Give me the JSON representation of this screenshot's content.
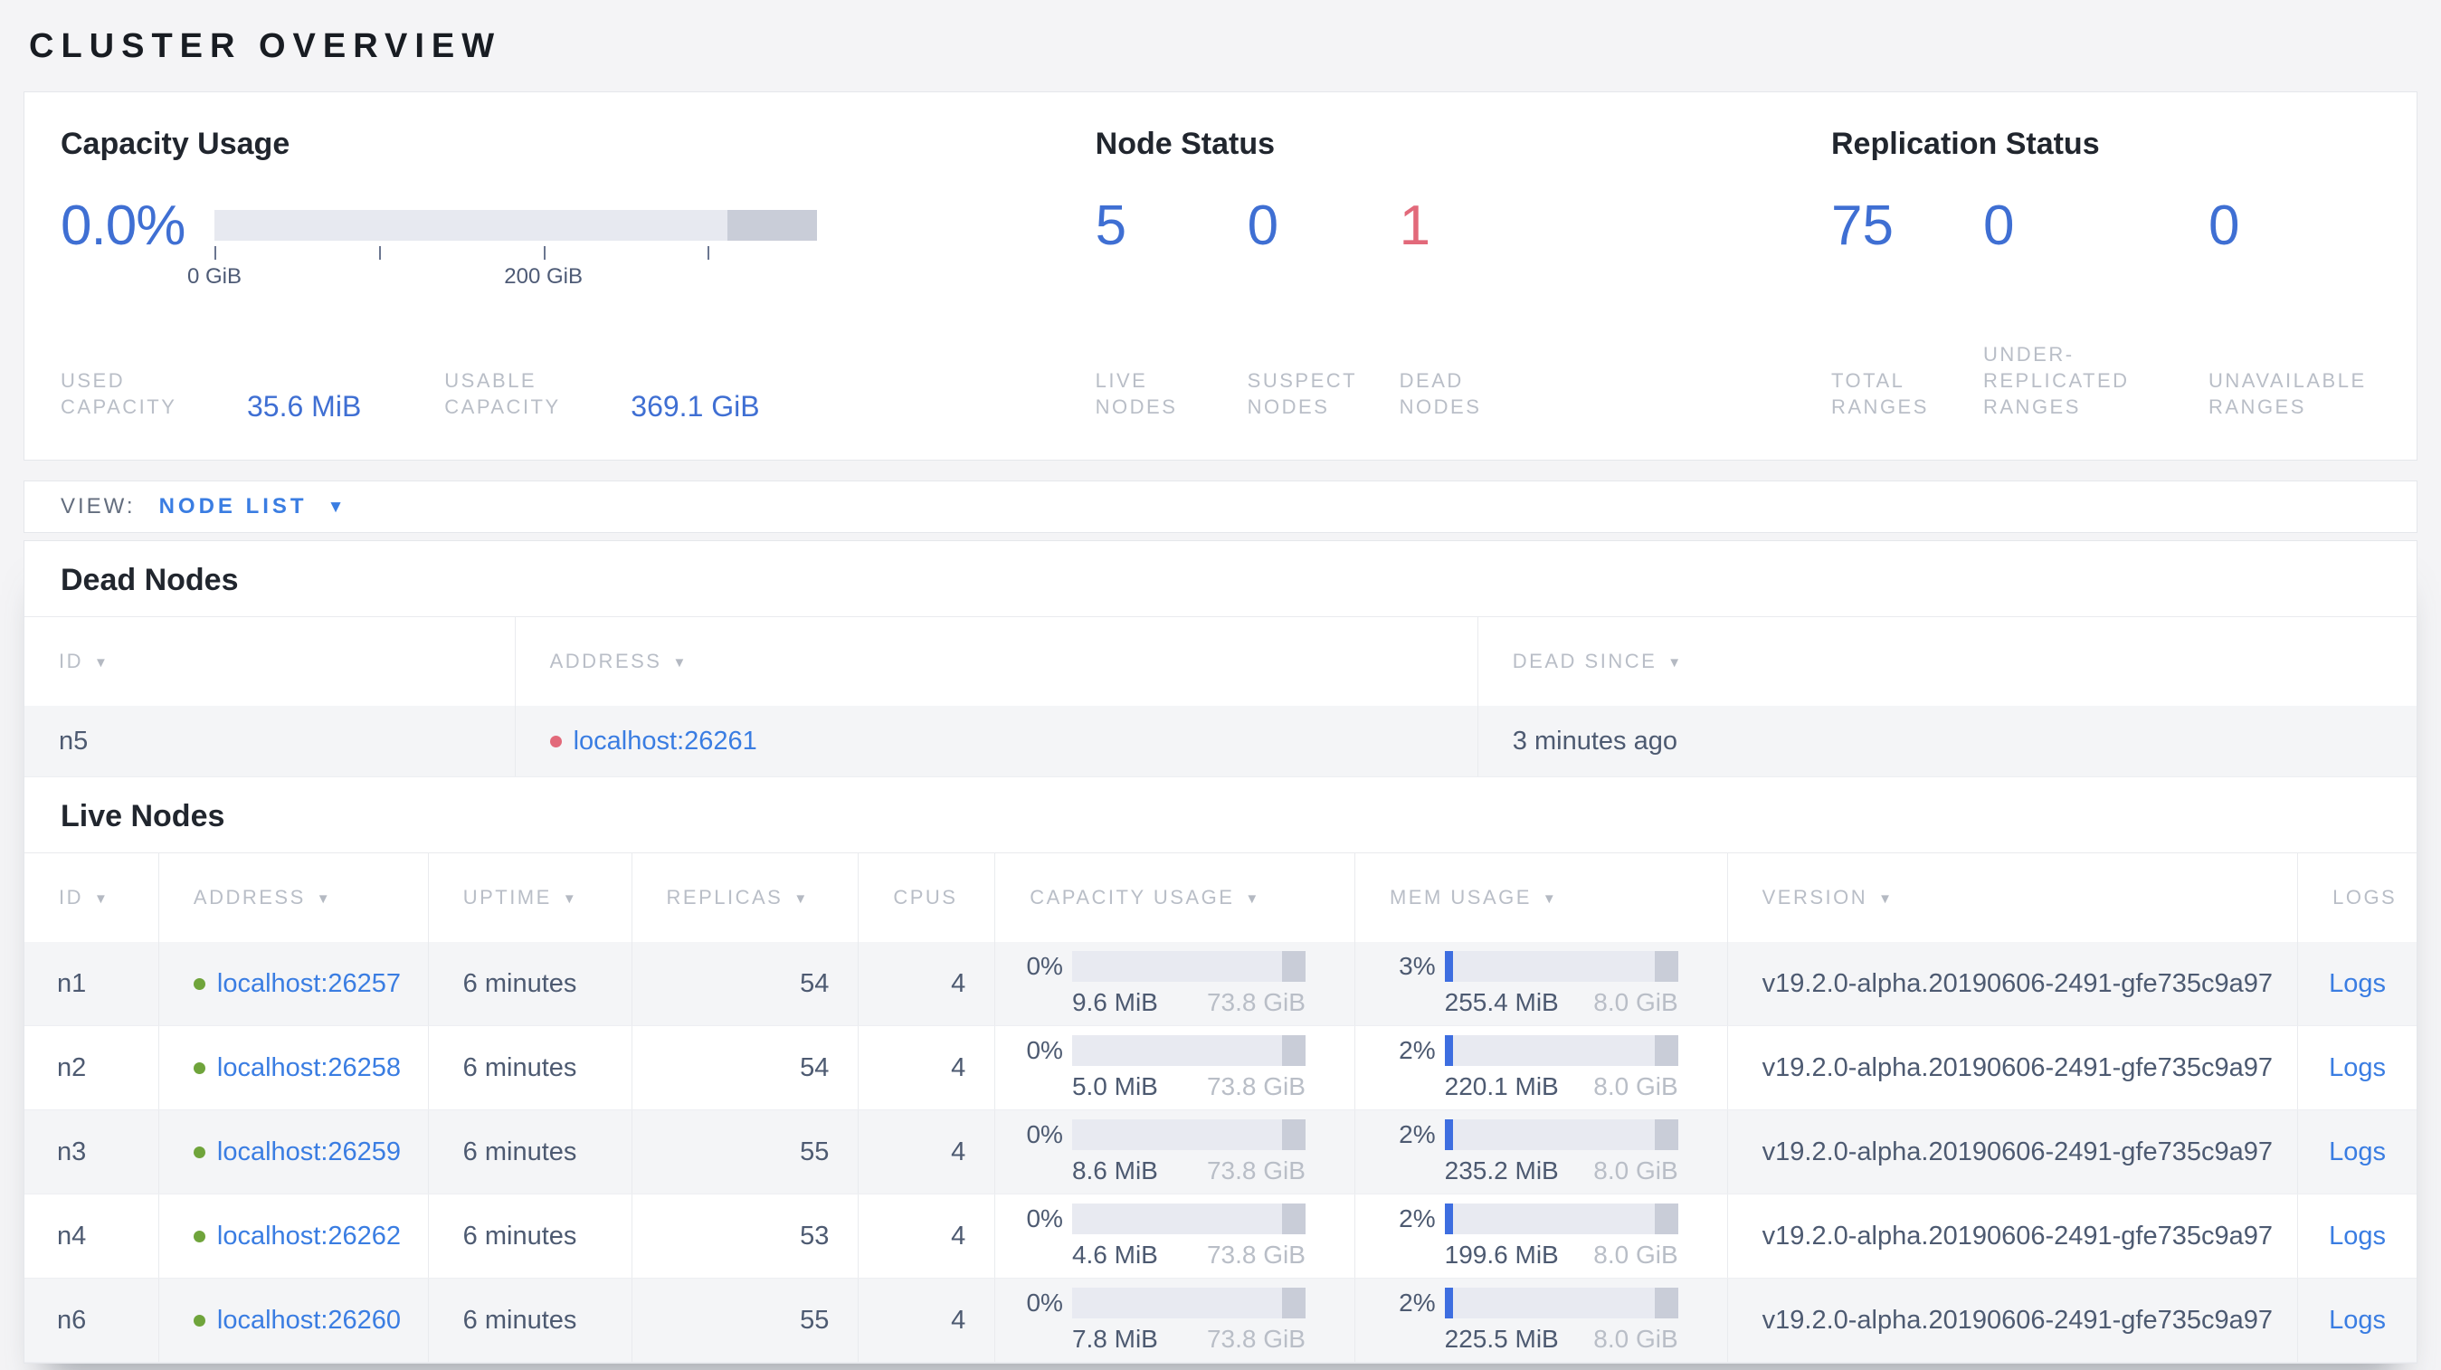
{
  "colors": {
    "number_blue": "#3f6fd3",
    "link_blue": "#3a7de2",
    "dead_red": "#e2697a",
    "live_green": "#6fa43b",
    "mem_fill_blue": "#3e6ee0"
  },
  "page": {
    "title": "CLUSTER OVERVIEW"
  },
  "summary": {
    "capacity": {
      "heading": "Capacity Usage",
      "percent": "0.0%",
      "bar": {
        "used_fraction": 0.0,
        "reserved_segment_fraction": 0.149,
        "tick_fractions": [
          0,
          0.273,
          0.546,
          0.819
        ],
        "tick_labels": [
          "0 GiB",
          "200 GiB"
        ],
        "tick_label_fractions": [
          0,
          0.546
        ]
      },
      "stats": [
        {
          "label": "USED CAPACITY",
          "value": "35.6 MiB"
        },
        {
          "label": "USABLE CAPACITY",
          "value": "369.1 GiB"
        }
      ]
    },
    "node_status": {
      "heading": "Node Status",
      "stats": [
        {
          "value": "5",
          "label": "LIVE NODES",
          "variant": "blue"
        },
        {
          "value": "0",
          "label": "SUSPECT NODES",
          "variant": "blue"
        },
        {
          "value": "1",
          "label": "DEAD NODES",
          "variant": "red"
        }
      ]
    },
    "replication": {
      "heading": "Replication Status",
      "stats": [
        {
          "value": "75",
          "label": "TOTAL RANGES",
          "variant": "blue"
        },
        {
          "value": "0",
          "label": "UNDER-REPLICATED RANGES",
          "variant": "blue"
        },
        {
          "value": "0",
          "label": "UNAVAILABLE RANGES",
          "variant": "blue"
        }
      ]
    }
  },
  "view_bar": {
    "label": "VIEW:",
    "selected": "NODE LIST",
    "caret": "▼"
  },
  "dead_nodes": {
    "heading": "Dead Nodes",
    "columns": [
      {
        "label": "ID",
        "sortable": true
      },
      {
        "label": "ADDRESS",
        "sortable": true
      },
      {
        "label": "DEAD SINCE",
        "sortable": true
      }
    ],
    "rows": [
      {
        "id": "n5",
        "address": "localhost:26261",
        "status": "dead",
        "dead_since": "3 minutes ago"
      }
    ]
  },
  "live_nodes": {
    "heading": "Live Nodes",
    "columns": [
      {
        "label": "ID",
        "sortable": true
      },
      {
        "label": "ADDRESS",
        "sortable": true
      },
      {
        "label": "UPTIME",
        "sortable": true
      },
      {
        "label": "REPLICAS",
        "sortable": true
      },
      {
        "label": "CPUS",
        "sortable": false
      },
      {
        "label": "CAPACITY USAGE",
        "sortable": true
      },
      {
        "label": "MEM USAGE",
        "sortable": true
      },
      {
        "label": "VERSION",
        "sortable": true
      },
      {
        "label": "LOGS",
        "sortable": false
      }
    ],
    "rows": [
      {
        "id": "n1",
        "address": "localhost:26257",
        "status": "live",
        "uptime": "6 minutes",
        "replicas": "54",
        "cpus": "4",
        "capacity": {
          "percent": "0%",
          "used": "9.6 MiB",
          "total": "73.8 GiB"
        },
        "memory": {
          "percent": "3%",
          "used": "255.4 MiB",
          "total": "8.0 GiB"
        },
        "version": "v19.2.0-alpha.20190606-2491-gfe735c9a97",
        "logs_label": "Logs"
      },
      {
        "id": "n2",
        "address": "localhost:26258",
        "status": "live",
        "uptime": "6 minutes",
        "replicas": "54",
        "cpus": "4",
        "capacity": {
          "percent": "0%",
          "used": "5.0 MiB",
          "total": "73.8 GiB"
        },
        "memory": {
          "percent": "2%",
          "used": "220.1 MiB",
          "total": "8.0 GiB"
        },
        "version": "v19.2.0-alpha.20190606-2491-gfe735c9a97",
        "logs_label": "Logs"
      },
      {
        "id": "n3",
        "address": "localhost:26259",
        "status": "live",
        "uptime": "6 minutes",
        "replicas": "55",
        "cpus": "4",
        "capacity": {
          "percent": "0%",
          "used": "8.6 MiB",
          "total": "73.8 GiB"
        },
        "memory": {
          "percent": "2%",
          "used": "235.2 MiB",
          "total": "8.0 GiB"
        },
        "version": "v19.2.0-alpha.20190606-2491-gfe735c9a97",
        "logs_label": "Logs"
      },
      {
        "id": "n4",
        "address": "localhost:26262",
        "status": "live",
        "uptime": "6 minutes",
        "replicas": "53",
        "cpus": "4",
        "capacity": {
          "percent": "0%",
          "used": "4.6 MiB",
          "total": "73.8 GiB"
        },
        "memory": {
          "percent": "2%",
          "used": "199.6 MiB",
          "total": "8.0 GiB"
        },
        "version": "v19.2.0-alpha.20190606-2491-gfe735c9a97",
        "logs_label": "Logs"
      },
      {
        "id": "n6",
        "address": "localhost:26260",
        "status": "live",
        "uptime": "6 minutes",
        "replicas": "55",
        "cpus": "4",
        "capacity": {
          "percent": "0%",
          "used": "7.8 MiB",
          "total": "73.8 GiB"
        },
        "memory": {
          "percent": "2%",
          "used": "225.5 MiB",
          "total": "8.0 GiB"
        },
        "version": "v19.2.0-alpha.20190606-2491-gfe735c9a97",
        "logs_label": "Logs"
      }
    ]
  }
}
